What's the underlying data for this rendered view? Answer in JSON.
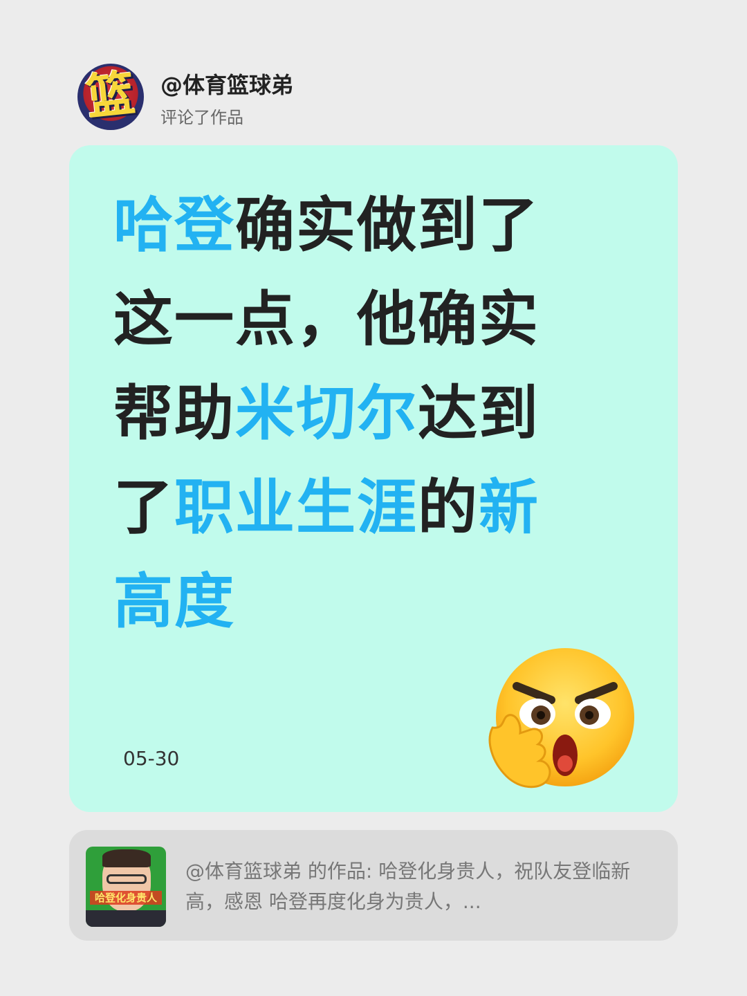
{
  "header": {
    "avatar_glyph": "篮",
    "username": "@体育篮球弟",
    "action": "评论了作品"
  },
  "card": {
    "background": "#c1fbec",
    "highlight_color": "#22b2f2",
    "segments": [
      {
        "text": "哈登",
        "hl": true
      },
      {
        "text": "确实做到了这一点，他确实帮助",
        "hl": false
      },
      {
        "text": "米切尔",
        "hl": true
      },
      {
        "text": "达到了",
        "hl": false
      },
      {
        "text": "职业生涯",
        "hl": true
      },
      {
        "text": "的",
        "hl": false
      },
      {
        "text": "新高度",
        "hl": true
      }
    ],
    "date": "05-30",
    "emoji": "thinking-angry-face-emoji"
  },
  "reference": {
    "thumb_banner": "哈登化身贵人",
    "text": "@体育篮球弟 的作品: 哈登化身贵人，祝队友登临新高，感恩 哈登再度化身为贵人，..."
  }
}
